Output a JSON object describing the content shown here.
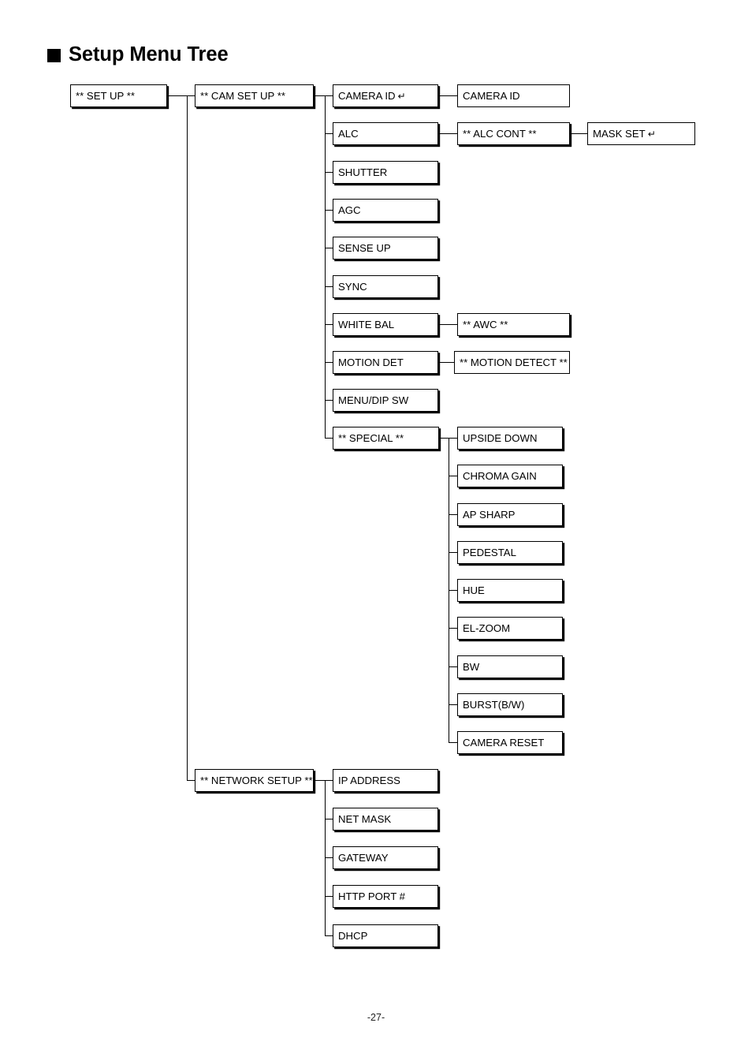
{
  "page": {
    "title": "Setup Menu Tree",
    "page_number": "-27-",
    "marker": "black-square-bullet"
  },
  "tree": {
    "root": {
      "label": "** SET UP **"
    },
    "level1": [
      {
        "label": "** CAM  SET UP **"
      },
      {
        "label": "** NETWORK SETUP **"
      }
    ],
    "cam_setup_children": [
      {
        "label": "CAMERA ID",
        "return_glyph": "↵"
      },
      {
        "label": "ALC"
      },
      {
        "label": "SHUTTER"
      },
      {
        "label": "AGC"
      },
      {
        "label": "SENSE UP"
      },
      {
        "label": "SYNC"
      },
      {
        "label": "WHITE BAL"
      },
      {
        "label": "MOTION DET"
      },
      {
        "label": "MENU/DIP SW"
      },
      {
        "label": "** SPECIAL **"
      }
    ],
    "camera_id_children": [
      {
        "label": "CAMERA ID"
      }
    ],
    "alc_children": [
      {
        "label": "** ALC CONT **"
      }
    ],
    "alc_cont_children": [
      {
        "label": "MASK SET",
        "return_glyph": "↵"
      }
    ],
    "white_bal_children": [
      {
        "label": "** AWC **"
      }
    ],
    "motion_det_children": [
      {
        "label": "** MOTION DETECT **"
      }
    ],
    "special_children": [
      {
        "label": "UPSIDE DOWN"
      },
      {
        "label": "CHROMA GAIN"
      },
      {
        "label": "AP SHARP"
      },
      {
        "label": "PEDESTAL"
      },
      {
        "label": "HUE"
      },
      {
        "label": "EL-ZOOM"
      },
      {
        "label": "BW"
      },
      {
        "label": "BURST(B/W)"
      },
      {
        "label": "CAMERA RESET"
      }
    ],
    "network_setup_children": [
      {
        "label": "IP ADDRESS"
      },
      {
        "label": "NET MASK"
      },
      {
        "label": "GATEWAY"
      },
      {
        "label": "HTTP PORT #"
      },
      {
        "label": "DHCP"
      }
    ]
  },
  "colors": {
    "ink": "#000000",
    "paper": "#ffffff"
  }
}
